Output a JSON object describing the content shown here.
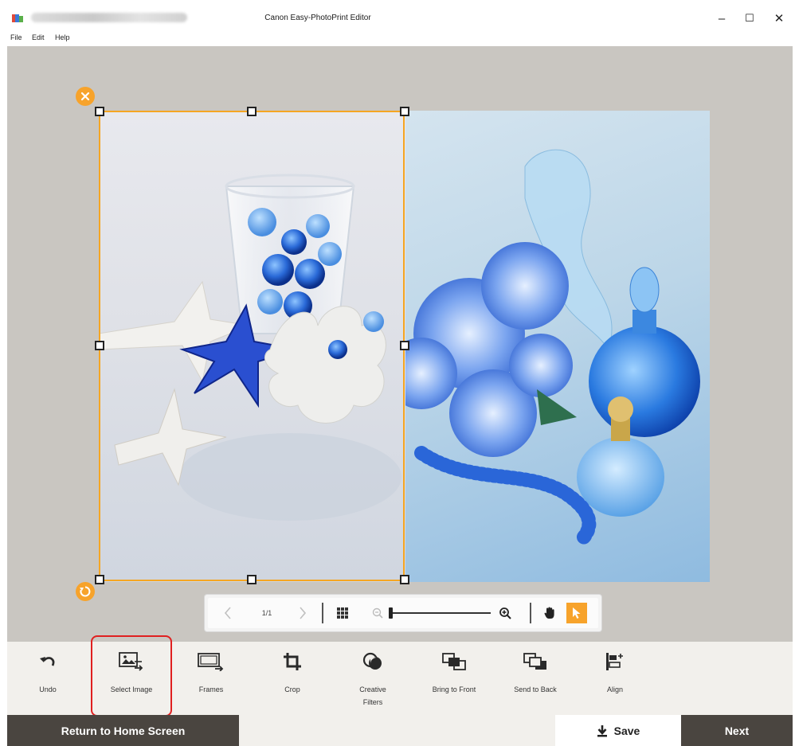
{
  "window": {
    "title": "Canon Easy-PhotoPrint Editor",
    "minimize_glyph": "–",
    "maximize_glyph": "☐",
    "close_glyph": "✕"
  },
  "menu": [
    "File",
    "Edit",
    "Help"
  ],
  "pager": {
    "page_indicator": "1/1",
    "prev_icon": "chevron-left-icon",
    "next_icon": "chevron-right-icon",
    "grid_icon": "grid-icon",
    "zoom_out_icon": "zoom-out-icon",
    "zoom_in_icon": "zoom-in-icon",
    "zoom_level": 0.0,
    "hand_icon": "hand-icon",
    "pointer_icon": "pointer-icon"
  },
  "tools": [
    {
      "label": "Undo",
      "icon": "undo-icon"
    },
    {
      "label": "Select Image",
      "icon": "select-image-icon"
    },
    {
      "label": "Frames",
      "icon": "frames-icon"
    },
    {
      "label": "Crop",
      "icon": "crop-icon"
    },
    {
      "label": "Creative Filters",
      "icon": "creative-filters-icon"
    },
    {
      "label": "Bring to Front",
      "icon": "bring-to-front-icon"
    },
    {
      "label": "Send to Back",
      "icon": "send-to-back-icon"
    },
    {
      "label": "Align",
      "icon": "align-icon"
    }
  ],
  "bottom": {
    "home_label": "Return to Home Screen",
    "save_label": "Save",
    "next_label": "Next"
  },
  "colors": {
    "accent": "#f7a32b",
    "highlight": "#e02020",
    "dark_button": "#4a4540",
    "canvas_bg": "#c9c6c1",
    "toolbar_bg": "#f2f0ec"
  }
}
